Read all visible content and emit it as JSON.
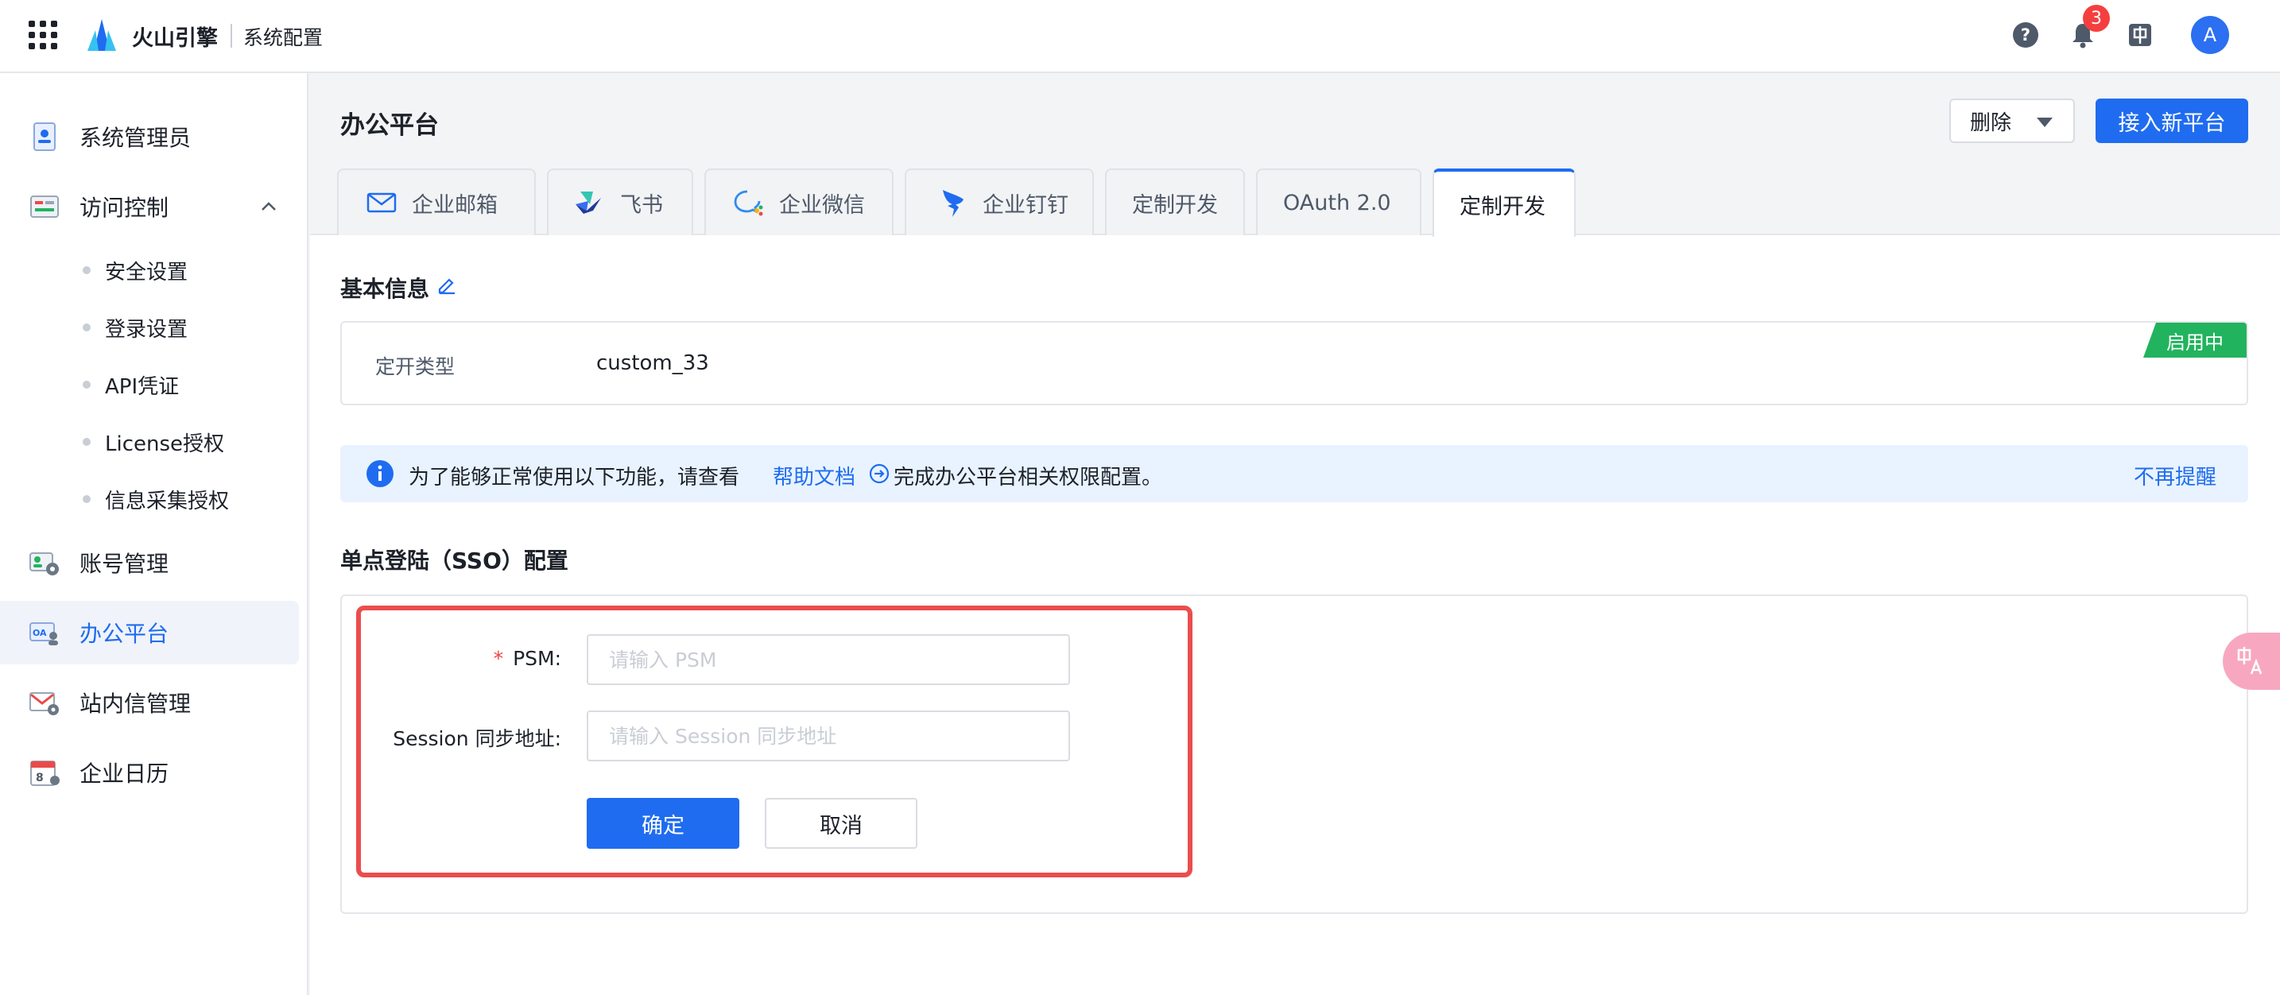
{
  "header": {
    "brand": "火山引擎",
    "subtitle": "系统配置",
    "notification_count": "3",
    "avatar_letter": "A"
  },
  "sidebar": {
    "items": [
      {
        "label": "系统管理员"
      },
      {
        "label": "访问控制"
      },
      {
        "label": "账号管理"
      },
      {
        "label": "办公平台"
      },
      {
        "label": "站内信管理"
      },
      {
        "label": "企业日历"
      }
    ],
    "sub_items": [
      {
        "label": "安全设置"
      },
      {
        "label": "登录设置"
      },
      {
        "label": "API凭证"
      },
      {
        "label": "License授权"
      },
      {
        "label": "信息采集授权"
      }
    ]
  },
  "page": {
    "title": "办公平台",
    "delete_label": "删除",
    "new_platform_label": "接入新平台"
  },
  "tabs": [
    {
      "label": "企业邮箱"
    },
    {
      "label": "飞书"
    },
    {
      "label": "企业微信"
    },
    {
      "label": "企业钉钉"
    },
    {
      "label": "定制开发"
    },
    {
      "label": "OAuth 2.0"
    },
    {
      "label": "定制开发"
    }
  ],
  "basic_info": {
    "title": "基本信息",
    "type_label": "定开类型",
    "type_value": "custom_33",
    "status": "启用中"
  },
  "alert": {
    "text_before": "为了能够正常使用以下功能，请查看",
    "link": "帮助文档",
    "text_after": "完成办公平台相关权限配置。",
    "dismiss": "不再提醒"
  },
  "sso": {
    "title": "单点登陆（SSO）配置",
    "psm_label": "PSM:",
    "psm_required": "*",
    "psm_placeholder": "请输入 PSM",
    "session_label": "Session 同步地址:",
    "session_placeholder": "请输入 Session 同步地址",
    "confirm": "确定",
    "cancel": "取消"
  },
  "colors": {
    "primary": "#1f6cf0",
    "success": "#22b35e",
    "highlight": "#ec4d4d",
    "danger": "#f53f3f"
  }
}
